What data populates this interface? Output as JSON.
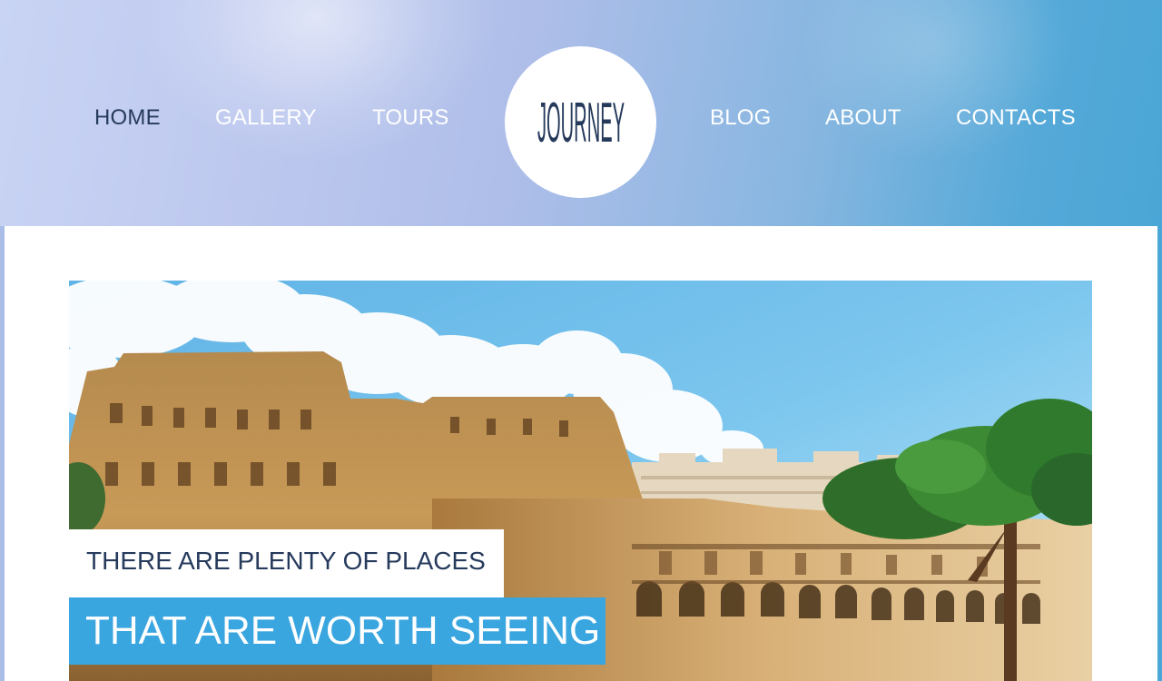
{
  "nav": {
    "left": [
      {
        "label": "HOME",
        "active": true
      },
      {
        "label": "GALLERY",
        "active": false
      },
      {
        "label": "TOURS",
        "active": false
      }
    ],
    "right": [
      {
        "label": "BLOG",
        "active": false
      },
      {
        "label": "ABOUT",
        "active": false
      },
      {
        "label": "CONTACTS",
        "active": false
      }
    ]
  },
  "logo": {
    "text": "JOURNEY",
    "icon": "journey-logo"
  },
  "hero": {
    "image": "colosseum-rome-photo",
    "caption_line1": "THERE ARE PLENTY OF PLACES",
    "caption_line2": "THAT ARE WORTH SEEING"
  },
  "colors": {
    "accent": "#3aa6e0",
    "nav_active": "#263a5c",
    "nav_text": "#ffffff",
    "caption_text": "#263a5c"
  }
}
